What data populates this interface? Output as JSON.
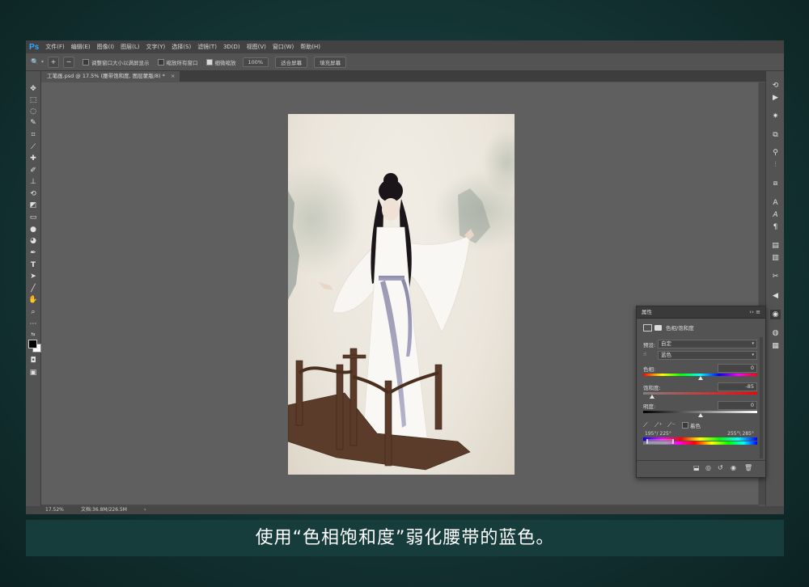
{
  "app": {
    "logo": "Ps",
    "menus": [
      "文件(F)",
      "编辑(E)",
      "图像(I)",
      "图层(L)",
      "文字(Y)",
      "选择(S)",
      "滤镜(T)",
      "3D(D)",
      "视图(V)",
      "窗口(W)",
      "帮助(H)"
    ]
  },
  "options": {
    "resize_windows": "调整窗口大小以满屏显示",
    "zoom_all": "缩放所有窗口",
    "scrubby_zoom": "细微缩放",
    "btn_100": "100%",
    "btn_fit": "适合屏幕",
    "btn_fill": "填充屏幕"
  },
  "document": {
    "tab_label": "工笔画.psd @ 17.5% (腰带饱和度, 图层蒙版/8) *",
    "tab_close": "×"
  },
  "status": {
    "zoom": "17.52%",
    "doc_size": "文档:36.8M/226.5M",
    "arrow": "›"
  },
  "properties": {
    "title": "属性",
    "header_controls": "›› ≡",
    "adjustment": "色相/饱和度",
    "preset_label": "预设:",
    "preset_value": "自定",
    "channel_value": "蓝色",
    "hue_label": "色相:",
    "hue_value": "0",
    "hue_level": 0.5,
    "sat_label": "饱和度:",
    "sat_value": "-85",
    "sat_level": 0.075,
    "light_label": "明度:",
    "light_value": "0",
    "light_level": 0.5,
    "colorize_label": "着色",
    "range_left": "195°/ 225°",
    "range_right": "255°\\ 285°"
  },
  "caption": "使用“色相饱和度”弱化腰带的蓝色。",
  "colors": {
    "background": "#163838",
    "app": "#535353",
    "ps_blue": "#31a8ff"
  }
}
